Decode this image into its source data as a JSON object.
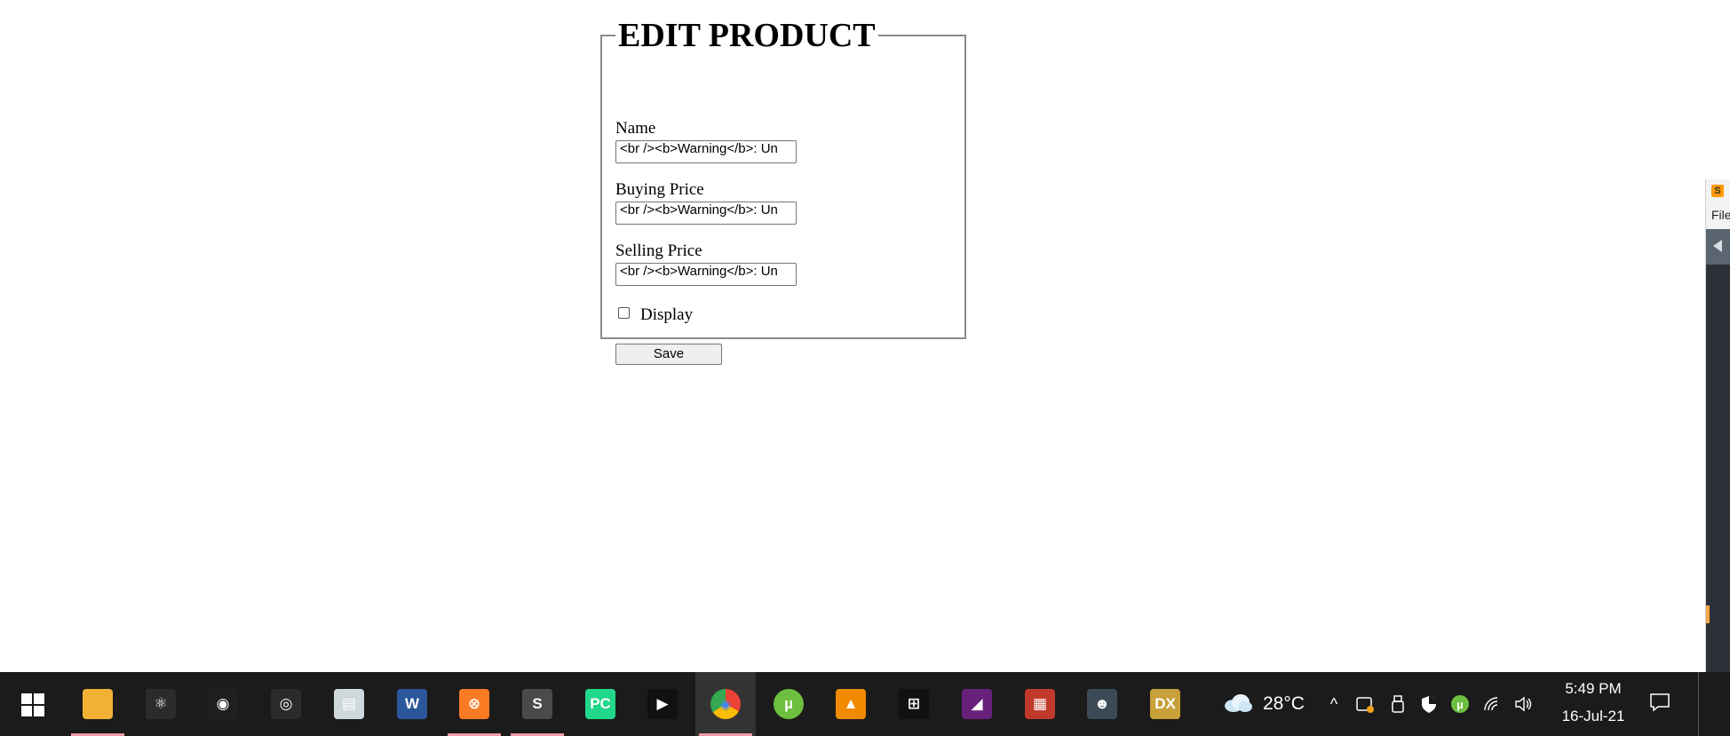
{
  "form": {
    "legend": "EDIT PRODUCT",
    "fields": [
      {
        "label": "Name",
        "value": "<br /><b>Warning</b>:  Un"
      },
      {
        "label": "Buying Price",
        "value": "<br /><b>Warning</b>:  Un"
      },
      {
        "label": "Selling Price",
        "value": "<br /><b>Warning</b>:  Un"
      }
    ],
    "display_label": "Display",
    "display_checked": false,
    "save_label": "Save"
  },
  "side_app": {
    "file_menu": "File",
    "logo_glyph": "S"
  },
  "taskbar": {
    "apps": [
      {
        "name": "file-explorer-icon",
        "color": "#f2b134",
        "glyph": "",
        "active": false,
        "running": true
      },
      {
        "name": "atom-icon",
        "color": "#2b2b2b",
        "glyph": "⚛",
        "active": false,
        "running": false
      },
      {
        "name": "nvidia-icon",
        "color": "#1f1f1f",
        "glyph": "◉",
        "active": false,
        "running": false
      },
      {
        "name": "obs-icon",
        "color": "#2b2b2b",
        "glyph": "◎",
        "active": false,
        "running": false
      },
      {
        "name": "performance-monitor-icon",
        "color": "#cfd8dc",
        "glyph": "▤",
        "active": false,
        "running": false
      },
      {
        "name": "word-icon",
        "color": "#2b579a",
        "glyph": "W",
        "active": false,
        "running": false
      },
      {
        "name": "xampp-icon",
        "color": "#fb7a24",
        "glyph": "⊗",
        "active": false,
        "running": true
      },
      {
        "name": "sublime-text-icon",
        "color": "#4a4a4a",
        "glyph": "S",
        "active": false,
        "running": true
      },
      {
        "name": "pycharm-icon",
        "color": "#21d789",
        "glyph": "PC",
        "active": false,
        "running": false
      },
      {
        "name": "media-player-icon",
        "color": "#111111",
        "glyph": "▶",
        "active": false,
        "running": false
      },
      {
        "name": "chrome-icon",
        "color": "#ea4335",
        "glyph": "◉",
        "active": true,
        "running": true
      },
      {
        "name": "utorrent-icon",
        "color": "#6cbf3f",
        "glyph": "µ",
        "active": false,
        "running": false
      },
      {
        "name": "vlc-icon",
        "color": "#f08a00",
        "glyph": "▲",
        "active": false,
        "running": false
      },
      {
        "name": "screen-capture-icon",
        "color": "#111111",
        "glyph": "⊞",
        "active": false,
        "running": false
      },
      {
        "name": "visual-studio-icon",
        "color": "#68217a",
        "glyph": "◢",
        "active": false,
        "running": false
      },
      {
        "name": "winrar-icon",
        "color": "#c0392b",
        "glyph": "▦",
        "active": false,
        "running": false
      },
      {
        "name": "game-soldier-icon",
        "color": "#3c4a57",
        "glyph": "☻",
        "active": false,
        "running": false
      },
      {
        "name": "deus-ex-icon",
        "color": "#c9a13b",
        "glyph": "DX",
        "active": false,
        "running": false
      }
    ],
    "weather_temp": "28°C",
    "time": "5:49 PM",
    "date": "16-Jul-21"
  }
}
